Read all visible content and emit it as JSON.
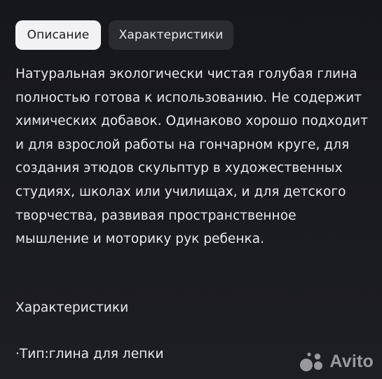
{
  "tabs": [
    {
      "label": "Описание",
      "active": true
    },
    {
      "label": "Характеристики",
      "active": false
    }
  ],
  "description": "Натуральная экологически чистая голубая глина полностью готова к использованию. Не содержит химических добавок. Одинаково хорошо подходит и для взрослой работы на гончарном круге, для создания этюдов скульптур в художественных студиях, школах или училищах, и для детского творчества, развивая пространственное мышление и моторику рук ребенка.",
  "specs_title": "Характеристики",
  "specs": [
    {
      "text": "·Тип:глина для лепки"
    }
  ],
  "watermark": {
    "text": "Avito",
    "icon": "avito-logo-icon"
  },
  "colors": {
    "background": "#1c1d21",
    "active_tab": "#f2f2f4",
    "inactive_tab": "#2b2c31",
    "text": "#e9e9ec"
  }
}
